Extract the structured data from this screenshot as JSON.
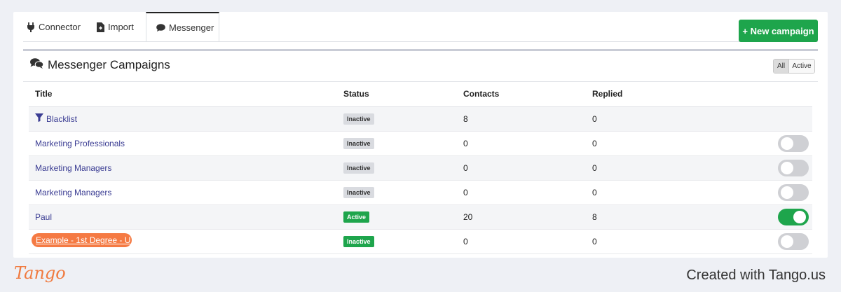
{
  "tabs": [
    {
      "label": "Connector",
      "icon": "plug-icon"
    },
    {
      "label": "Import",
      "icon": "file-import-icon"
    },
    {
      "label": "Messenger",
      "icon": "chat-bubble-icon",
      "active": true
    }
  ],
  "new_campaign_label": "+ New campaign",
  "panel": {
    "title": "Messenger Campaigns",
    "filters": {
      "all": "All",
      "active": "Active",
      "selected": "All"
    }
  },
  "table": {
    "headers": {
      "title": "Title",
      "status": "Status",
      "contacts": "Contacts",
      "replied": "Replied"
    },
    "rows": [
      {
        "title": "Blacklist",
        "status": "Inactive",
        "contacts": "8",
        "replied": "0"
      },
      {
        "title": "Marketing Professionals",
        "status": "Inactive",
        "contacts": "0",
        "replied": "0",
        "toggle": "off"
      },
      {
        "title": "Marketing Managers",
        "status": "Inactive",
        "contacts": "0",
        "replied": "0",
        "toggle": "off"
      },
      {
        "title": "Marketing Managers",
        "status": "Inactive",
        "contacts": "0",
        "replied": "0",
        "toggle": "off"
      },
      {
        "title": "Paul",
        "status": "Active",
        "contacts": "20",
        "replied": "8",
        "toggle": "on"
      },
      {
        "title": "Example - 1st Degree - U",
        "status": "Inactive",
        "contacts": "0",
        "replied": "0",
        "toggle": "off"
      }
    ]
  },
  "footer": {
    "logo": "Tango",
    "credit": "Created with Tango.us"
  },
  "colors": {
    "accent_green": "#1ea54c",
    "link": "#3b3d93",
    "highlight": "#f57a43"
  }
}
